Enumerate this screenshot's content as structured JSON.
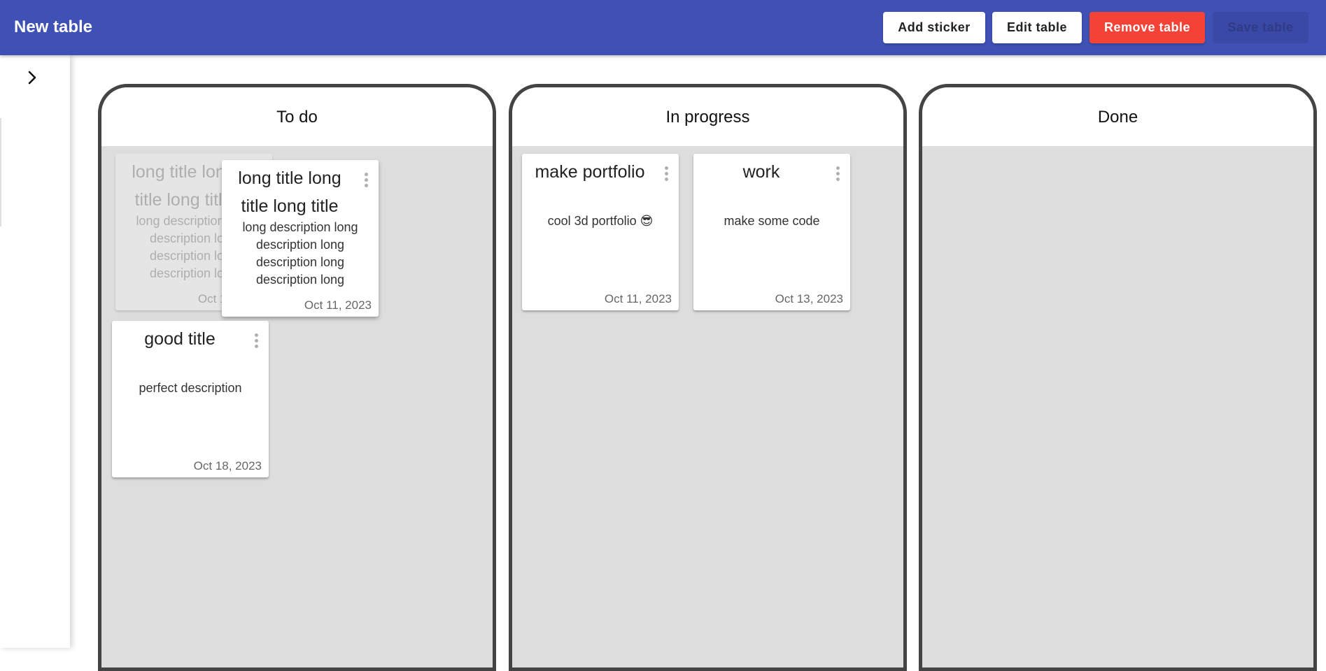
{
  "app": {
    "title": "New table"
  },
  "toolbar": {
    "add_sticker": "Add sticker",
    "edit_table": "Edit table",
    "remove_table": "Remove table",
    "save_table": "Save table"
  },
  "sidebar": {
    "toggle_icon": "chevron-right-icon"
  },
  "columns": [
    {
      "title": "To do",
      "cards": [
        {
          "title": "long title long title long title",
          "description": "long description long description long description long description long",
          "date": "Oct 11, 2023",
          "state": "drag-placeholder"
        },
        {
          "title": "long title long title long title",
          "description": "long description long description long description long description long",
          "date": "Oct 11, 2023",
          "state": "dragging"
        },
        {
          "title": "good title",
          "description": "perfect description",
          "date": "Oct 18, 2023"
        }
      ]
    },
    {
      "title": "In progress",
      "cards": [
        {
          "title": "make portfolio",
          "description": "cool 3d portfolio 😎",
          "date": "Oct 11, 2023"
        },
        {
          "title": "work",
          "description": "make some code",
          "date": "Oct 13, 2023"
        }
      ]
    },
    {
      "title": "Done",
      "cards": []
    }
  ],
  "colors": {
    "appbar": "#3f51b5",
    "remove_button": "#f44336",
    "column_border": "#444444",
    "column_body": "#dddddd"
  }
}
